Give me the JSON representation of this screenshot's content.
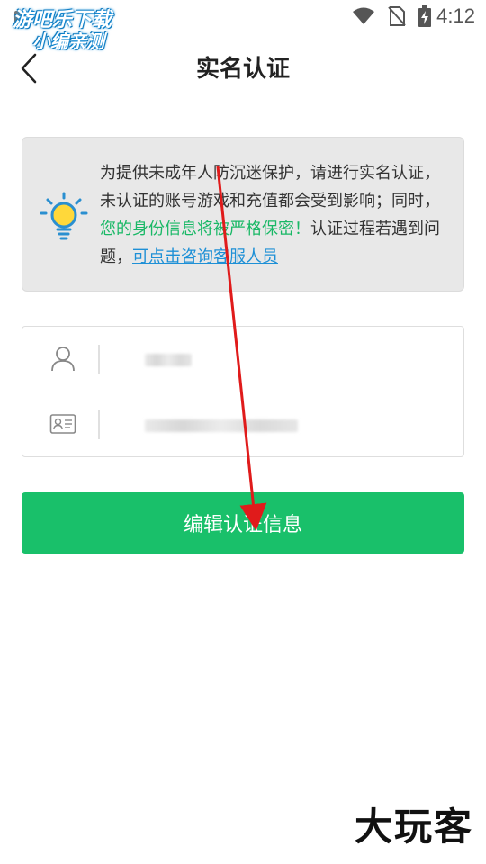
{
  "status_bar": {
    "time": "4:12",
    "icons": [
      "wifi-icon",
      "no-sim-icon",
      "battery-charging-icon"
    ]
  },
  "watermark_top": {
    "line1": "游吧乐下载",
    "line2": "小编亲测"
  },
  "nav": {
    "title": "实名认证",
    "back_icon": "chevron-left-icon"
  },
  "notice": {
    "icon": "lightbulb-icon",
    "text_before": "为提供未成年人防沉迷保护，请进行实名认证，未认证的账号游戏和充值都会受到影响；同时，",
    "text_highlight": "您的身份信息将被严格保密！",
    "text_after": "认证过程若遇到问题，",
    "link_text": "可点击咨询客服人员",
    "highlight_color": "#19b866",
    "link_color": "#1e90d6"
  },
  "form": {
    "name_field": {
      "icon": "user-icon"
    },
    "id_field": {
      "icon": "id-card-icon"
    }
  },
  "submit_button": {
    "label": "编辑认证信息",
    "color": "#19c06a"
  },
  "watermark_bottom": {
    "text": "大玩客"
  }
}
